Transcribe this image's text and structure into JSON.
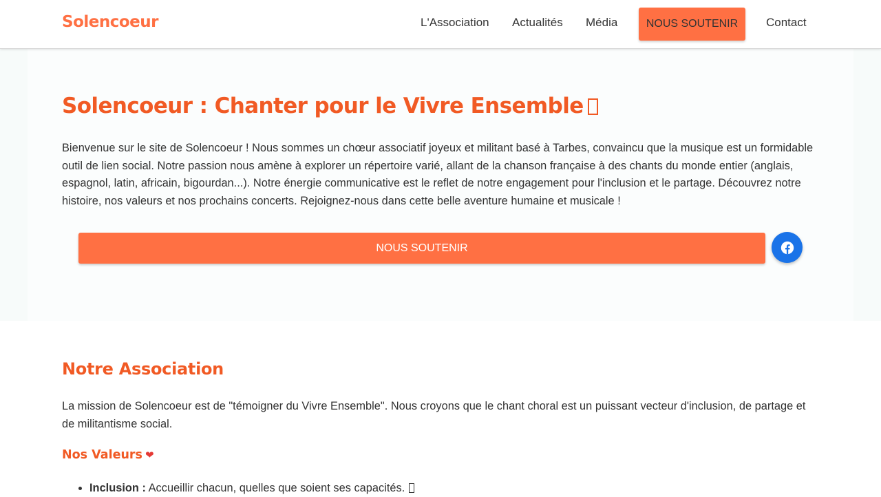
{
  "header": {
    "logo": "Solencoeur",
    "nav": [
      {
        "label": "L'Association"
      },
      {
        "label": "Actualités"
      },
      {
        "label": "Média"
      },
      {
        "label": "NOUS SOUTENIR"
      },
      {
        "label": "Contact"
      }
    ]
  },
  "hero": {
    "title": "Solencoeur : Chanter pour le Vivre Ensemble",
    "text": "Bienvenue sur le site de Solencoeur ! Nous sommes un chœur associatif joyeux et militant basé à Tarbes, convaincu que la musique est un formidable outil de lien social. Notre passion nous amène à explorer un répertoire varié, allant de la chanson française à des chants du monde entier (anglais, espagnol, latin, africain, bigourdan...). Notre énergie communicative est le reflet de notre engagement pour l'inclusion et le partage. Découvrez notre histoire, nos valeurs et nos prochains concerts. Rejoignez-nous dans cette belle aventure humaine et musicale !",
    "cta_label": "NOUS SOUTENIR",
    "facebook_icon": "facebook-icon"
  },
  "association": {
    "title": "Notre Association",
    "text": "La mission de Solencoeur est de \"témoigner du Vivre Ensemble\". Nous croyons que le chant choral est un puissant vecteur d'inclusion, de partage et de militantisme social.",
    "values_title": "Nos Valeurs",
    "values_icon": "heart-icon",
    "values": [
      {
        "label": "Inclusion :",
        "text": "Accueillir chacun, quelles que soient ses capacités."
      }
    ]
  },
  "colors": {
    "accent": "#ff7043",
    "heading": "#f15a24",
    "facebook": "#1a73e8"
  }
}
